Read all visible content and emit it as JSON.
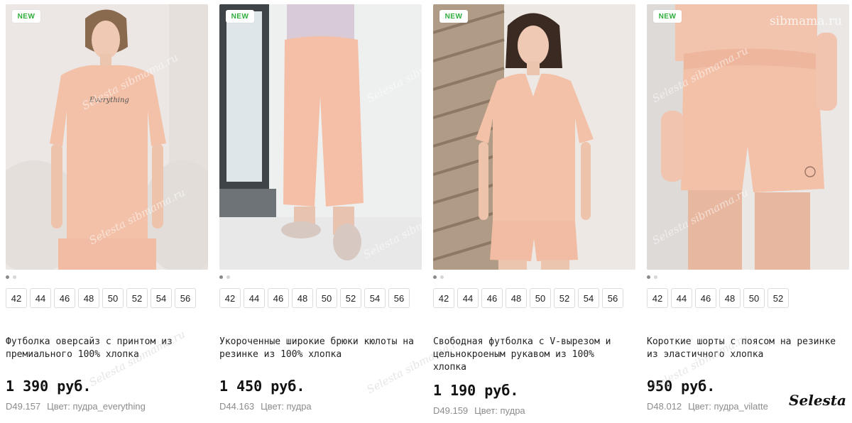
{
  "products": [
    {
      "badge": "NEW",
      "photo_icon": "tshirt-oversize-photo",
      "sizes": [
        "42",
        "44",
        "46",
        "48",
        "50",
        "52",
        "54",
        "56"
      ],
      "title": "Футболка оверсайз с принтом из премиального 100% хлопка",
      "price": "1 390 руб.",
      "sku": "D49.157",
      "color": "Цвет: пудра_everything"
    },
    {
      "badge": "NEW",
      "photo_icon": "culottes-photo",
      "sizes": [
        "42",
        "44",
        "46",
        "48",
        "50",
        "52",
        "54",
        "56"
      ],
      "title": "Укороченные широкие брюки кюлоты на резинке из 100% хлопка",
      "price": "1 450 руб.",
      "sku": "D44.163",
      "color": "Цвет: пудра"
    },
    {
      "badge": "NEW",
      "photo_icon": "vneck-tshirt-photo",
      "sizes": [
        "42",
        "44",
        "46",
        "48",
        "50",
        "52",
        "54",
        "56"
      ],
      "title": "Свободная футболка с V-вырезом и цельнокроеным рукавом из 100% хлопка",
      "price": "1 190 руб.",
      "sku": "D49.159",
      "color": "Цвет: пудра"
    },
    {
      "badge": "NEW",
      "photo_icon": "shorts-photo",
      "sizes": [
        "42",
        "44",
        "46",
        "48",
        "50",
        "52"
      ],
      "title": "Короткие шорты с поясом на резинке из эластичного хлопка",
      "price": "950 руб.",
      "sku": "D48.012",
      "color": "Цвет: пудра_vilatte"
    }
  ],
  "watermarks": {
    "site": "sibmama.ru",
    "diagonal": "Selesta sibmama.ru",
    "brand": "Selesta"
  },
  "colors": {
    "badge_text": "#2fae3c",
    "product_peach": "#f3c0a8",
    "meta_grey": "#8c8c8c"
  }
}
